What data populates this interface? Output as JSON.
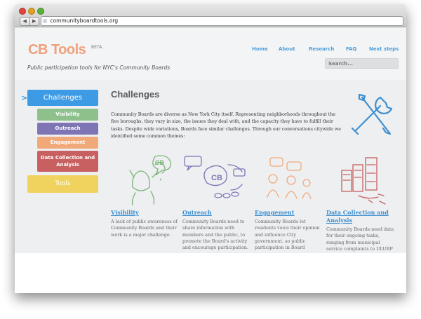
{
  "browser": {
    "url": "communityboardtools.org",
    "nav_back": "◀",
    "nav_forward": "▶",
    "globe_icon": "globe-icon"
  },
  "header": {
    "logo": "CB Tools",
    "beta": "BETA",
    "tagline": "Public participation tools for NYC's Community Boards",
    "nav": [
      "Home",
      "About",
      "Research",
      "FAQ",
      "Next steps"
    ],
    "search_placeholder": "Search..."
  },
  "sidebar": {
    "items": [
      {
        "label": "Challenges",
        "color": "#3d9ae4"
      },
      {
        "label": "Visibility",
        "color": "#8ec08c"
      },
      {
        "label": "Outreach",
        "color": "#7f75b5"
      },
      {
        "label": "Engagement",
        "color": "#f2a97a"
      },
      {
        "label": "Data Collection and Analysis",
        "color": "#c85f60"
      },
      {
        "label": "Tools",
        "color": "#f0d35e"
      }
    ]
  },
  "main": {
    "title": "Challenges",
    "intro": "Community Boards are diverse as New York City itself. Representing neighborhoods throughout the five boroughs, they vary in size, the issues they deal with, and the capacity they have to fulfill their tasks. Despite wide variations, Boards face similar challenges. Through our conversations citywide we identified some common themes:",
    "columns": [
      {
        "title": "Visibility",
        "text": "A lack of public awareness of Community Boards and their work is a major challenge."
      },
      {
        "title": "Outreach",
        "text": "Community Boards need to share information with members and the public, to promote the Board's activity and encourage participation."
      },
      {
        "title": "Engagement",
        "text": "Community Boards let residents voice their opinion and influence City government, so public participation in Board"
      },
      {
        "title": "Data Collection and Analysis",
        "text": "Community Boards need data for their ongoing tasks, ranging from municipal service complaints to ULURP"
      }
    ]
  },
  "illustration_labels": {
    "cb_speech": "CB",
    "cb_bubble": "CB"
  }
}
